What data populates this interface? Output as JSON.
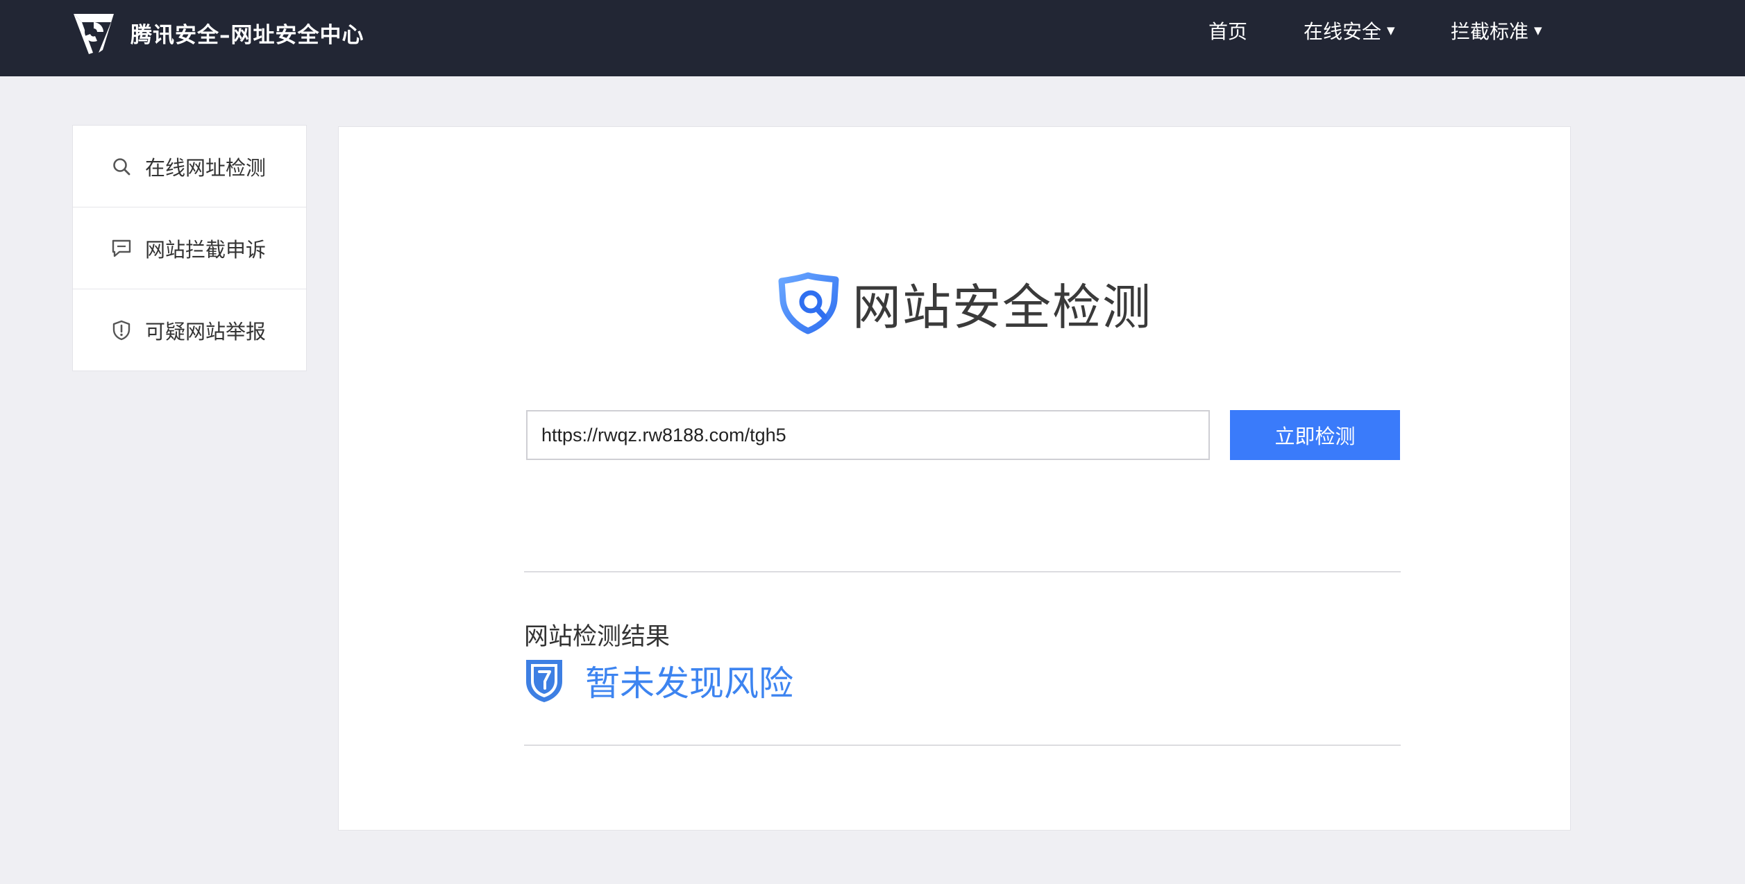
{
  "header": {
    "brand_name": "腾讯安全–网址安全中心",
    "nav": [
      {
        "label": "首页",
        "has_dropdown": false
      },
      {
        "label": "在线安全",
        "has_dropdown": true
      },
      {
        "label": "拦截标准",
        "has_dropdown": true
      }
    ]
  },
  "sidebar": {
    "items": [
      {
        "label": "在线网址检测",
        "icon": "search-icon"
      },
      {
        "label": "网站拦截申诉",
        "icon": "message-icon"
      },
      {
        "label": "可疑网站举报",
        "icon": "shield-alert-icon"
      }
    ]
  },
  "main": {
    "hero_title": "网站安全检测",
    "url_input_value": "https://rwqz.rw8188.com/tgh5",
    "check_button_label": "立即检测",
    "result_heading": "网站检测结果",
    "result_status": "暂未发现风险"
  },
  "colors": {
    "topbar_bg": "#222634",
    "accent_blue": "#3a7bfa",
    "result_blue": "#3d84f0",
    "page_bg": "#efeff3"
  }
}
